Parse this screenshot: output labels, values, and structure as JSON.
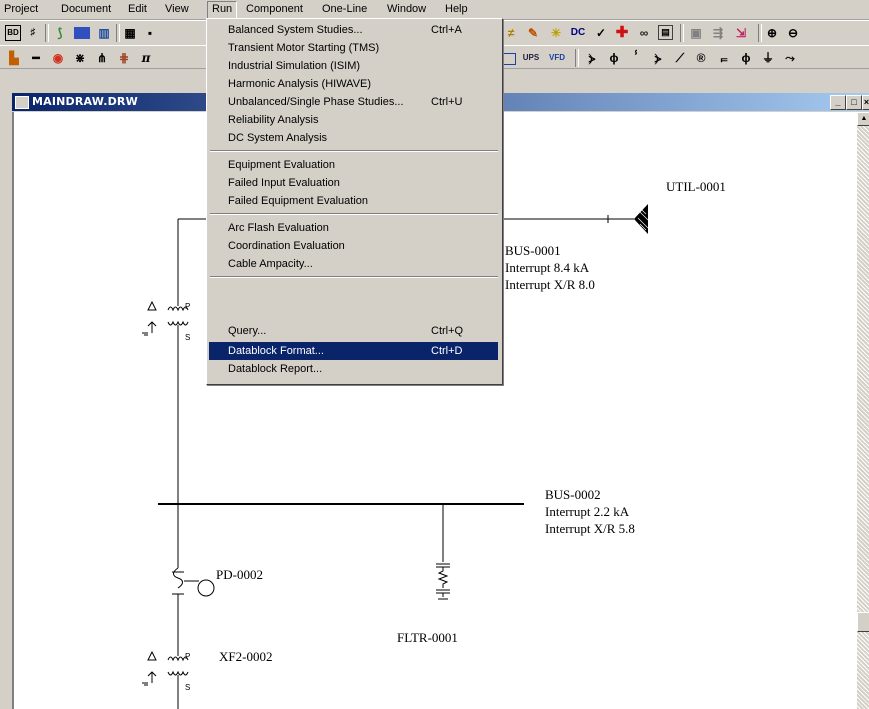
{
  "menubar": {
    "items": [
      "Project",
      "Document",
      "Edit",
      "View",
      "Run",
      "Component",
      "One-Line",
      "Window",
      "Help"
    ]
  },
  "toolbar1": {
    "icons": [
      "system-studies-icon",
      "fault-icon",
      "rainbow-icon",
      "report-icon",
      "chart-icon",
      "table-icon",
      "save-icon",
      "wire-icon",
      "brush-icon",
      "bulb-icon",
      "dc-icon",
      "check-icon",
      "plus-icon",
      "binoculars-icon",
      "grid-icon",
      "layout-icon",
      "flow-icon",
      "export-icon",
      "zoom-in-icon",
      "zoom-out-icon"
    ],
    "labels": {
      "dc": "DC"
    }
  },
  "toolbar2": {
    "icons": [
      "bus-icon",
      "line-icon",
      "motor-icon",
      "transformer-icon",
      "xfmr3-icon",
      "cable-icon",
      "pi-icon",
      "screen-icon",
      "ups-icon",
      "vfd-icon",
      "breaker1-icon",
      "fuse-icon",
      "switch-icon",
      "relay-icon",
      "pd-icon",
      "registered-icon",
      "reactor-icon",
      "load-icon",
      "ground-icon",
      "arrow-icon"
    ],
    "labels": {
      "pi": "π",
      "ups": "UPS",
      "vfd": "VFD"
    }
  },
  "window": {
    "title": "MAINDRAW.DRW"
  },
  "run_menu": {
    "groups": [
      [
        {
          "label": "Balanced System Studies...",
          "shortcut": "Ctrl+A"
        },
        {
          "label": "Transient Motor Starting (TMS)",
          "shortcut": ""
        },
        {
          "label": "Industrial Simulation (ISIM)",
          "shortcut": ""
        },
        {
          "label": "Harmonic Analysis (HIWAVE)",
          "shortcut": ""
        },
        {
          "label": "Unbalanced/Single Phase Studies...",
          "shortcut": "Ctrl+U"
        },
        {
          "label": "Reliability Analysis",
          "shortcut": ""
        },
        {
          "label": "DC System Analysis",
          "shortcut": ""
        }
      ],
      [
        {
          "label": "Equipment Evaluation",
          "shortcut": ""
        },
        {
          "label": "Failed Input Evaluation",
          "shortcut": ""
        },
        {
          "label": "Failed Equipment Evaluation",
          "shortcut": ""
        }
      ],
      [
        {
          "label": "Arc Flash Evaluation",
          "shortcut": ""
        },
        {
          "label": "Coordination Evaluation",
          "shortcut": ""
        },
        {
          "label": "Cable Ampacity...",
          "shortcut": ""
        }
      ],
      [
        {
          "label": "Query...",
          "shortcut": "Ctrl+Q"
        },
        {
          "label": "Datablock Format...",
          "shortcut": "Ctrl+D",
          "highlighted": true
        },
        {
          "label": "Datablock Report...",
          "shortcut": ""
        }
      ]
    ]
  },
  "diagram": {
    "util": {
      "name": "UTIL-0001"
    },
    "bus1": {
      "name": "BUS-0001",
      "interrupt": "Interrupt 8.4 kA",
      "xr": "Interrupt X/R 8.0"
    },
    "bus2": {
      "name": "BUS-0002",
      "interrupt": "Interrupt 2.2 kA",
      "xr": "Interrupt X/R 5.8"
    },
    "pd": {
      "name": "PD-0002"
    },
    "filter": {
      "name": "FLTR-0001"
    },
    "xf2": {
      "name": "XF2-0002"
    },
    "xfmr_labels": {
      "primary": "P",
      "secondary": "S"
    }
  },
  "colors": {
    "highlight": "#0a246a",
    "title_start": "#0a246a",
    "title_end": "#a6caf0",
    "menu_bg": "#d4d0c8"
  }
}
